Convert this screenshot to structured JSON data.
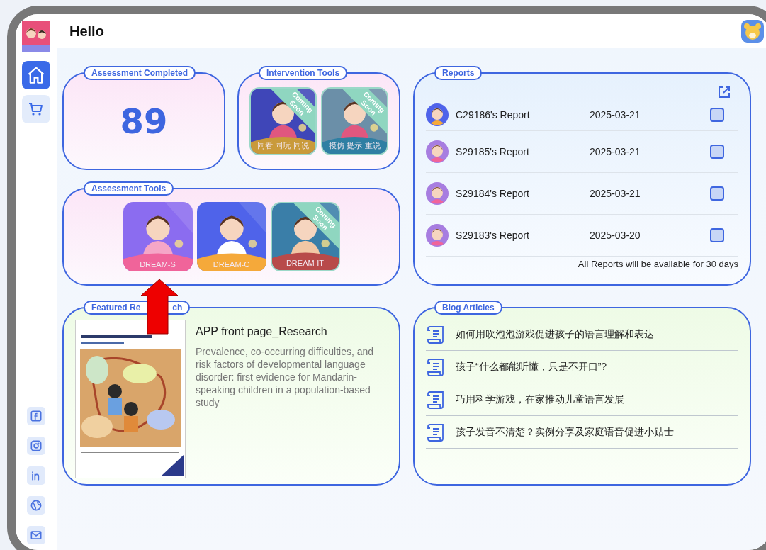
{
  "header": {
    "title": "Hello"
  },
  "sidebar": {
    "items": [
      {
        "kind": "home",
        "selected": true
      },
      {
        "kind": "cart",
        "selected": false
      }
    ],
    "social": [
      {
        "kind": "facebook"
      },
      {
        "kind": "instagram"
      },
      {
        "kind": "linkedin"
      },
      {
        "kind": "globe"
      },
      {
        "kind": "mail"
      }
    ]
  },
  "assessment_completed": {
    "title": "Assessment Completed",
    "count": "89"
  },
  "intervention_tools": {
    "title": "Intervention Tools",
    "tiles": [
      {
        "caption": "同看 同玩 同说",
        "ribbon": "Coming Soon",
        "kind": "mother-bubbles"
      },
      {
        "caption": "模仿 提示 重说",
        "ribbon": "Coming Soon",
        "kind": "mother-toy"
      }
    ]
  },
  "assessment_tools": {
    "title": "Assessment Tools",
    "tiles": [
      {
        "caption": "DREAM-S",
        "kind": "girl"
      },
      {
        "caption": "DREAM-C",
        "kind": "boy"
      },
      {
        "caption": "DREAM-IT",
        "ribbon": "Coming Soon",
        "kind": "baby"
      }
    ]
  },
  "featured_research": {
    "title_parts": [
      "Featured Re",
      "ch"
    ],
    "article_title": "APP front page_Research",
    "summary": "Prevalence, co-occurring difficulties, and risk factors of developmental language disorder: first evidence for Mandarin-speaking children in a population-based study"
  },
  "reports": {
    "title": "Reports",
    "rows": [
      {
        "name": "C29186's Report",
        "date": "2025-03-21",
        "checked": false,
        "kind": "boy"
      },
      {
        "name": "S29185's Report",
        "date": "2025-03-21",
        "checked": false,
        "kind": "girl"
      },
      {
        "name": "S29184's Report",
        "date": "2025-03-21",
        "checked": false,
        "kind": "girl"
      },
      {
        "name": "S29183's Report",
        "date": "2025-03-20",
        "checked": false,
        "kind": "girl"
      }
    ],
    "note": "All Reports will be available for 30 days"
  },
  "blog": {
    "title": "Blog Articles",
    "articles": [
      "如何用吹泡泡游戏促进孩子的语言理解和表达",
      "孩子“什么都能听懂，只是不开口”?",
      "巧用科学游戏，在家推动儿童语言发展",
      "孩子发音不清楚？实例分享及家庭语音促进小贴士"
    ]
  }
}
